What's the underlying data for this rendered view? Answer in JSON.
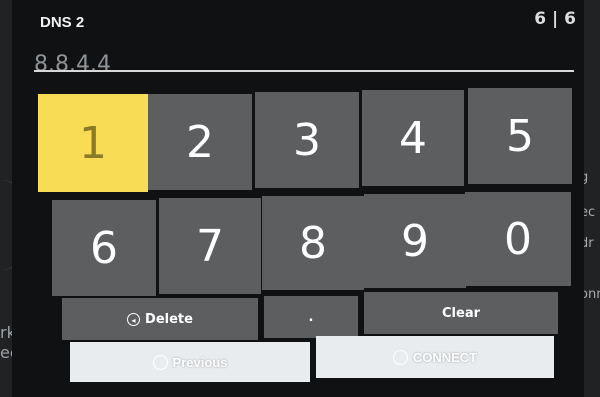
{
  "dialog": {
    "title": "DNS 2",
    "page_counter": "6 | 6",
    "value": "8.8.4.4"
  },
  "keypad": {
    "row1": [
      "1",
      "2",
      "3",
      "4",
      "5"
    ],
    "row2": [
      "6",
      "7",
      "8",
      "9",
      "0"
    ],
    "delete_label": "Delete",
    "dot_label": ".",
    "clear_label": "Clear",
    "selected_key": "1"
  },
  "actions": {
    "previous_label": "Previous",
    "connect_label": "CONNECT"
  },
  "background": {
    "left_line1": "rk",
    "left_line2": "ected)",
    "right_lines": [
      "g",
      "ec",
      "dr",
      "onn"
    ]
  },
  "colors": {
    "key": "#5c5e60",
    "selected": "#f9dc56",
    "panel": "#0f1113"
  }
}
